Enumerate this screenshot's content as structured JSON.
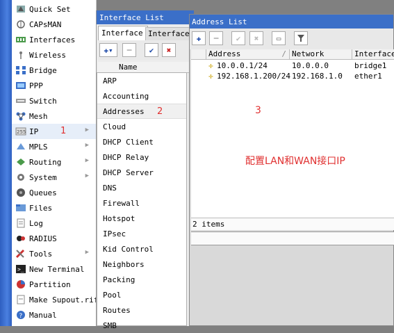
{
  "main_menu": [
    {
      "label": "Quick Set",
      "icon": "quick-set-icon"
    },
    {
      "label": "CAPsMAN",
      "icon": "capsman-icon"
    },
    {
      "label": "Interfaces",
      "icon": "interfaces-icon"
    },
    {
      "label": "Wireless",
      "icon": "wireless-icon"
    },
    {
      "label": "Bridge",
      "icon": "bridge-icon"
    },
    {
      "label": "PPP",
      "icon": "ppp-icon"
    },
    {
      "label": "Switch",
      "icon": "switch-icon"
    },
    {
      "label": "Mesh",
      "icon": "mesh-icon"
    },
    {
      "label": "IP",
      "icon": "ip-icon"
    },
    {
      "label": "MPLS",
      "icon": "mpls-icon"
    },
    {
      "label": "Routing",
      "icon": "routing-icon"
    },
    {
      "label": "System",
      "icon": "system-icon"
    },
    {
      "label": "Queues",
      "icon": "queues-icon"
    },
    {
      "label": "Files",
      "icon": "files-icon"
    },
    {
      "label": "Log",
      "icon": "log-icon"
    },
    {
      "label": "RADIUS",
      "icon": "radius-icon"
    },
    {
      "label": "Tools",
      "icon": "tools-icon"
    },
    {
      "label": "New Terminal",
      "icon": "terminal-icon"
    },
    {
      "label": "Partition",
      "icon": "partition-icon"
    },
    {
      "label": "Make Supout.rif",
      "icon": "supout-icon"
    },
    {
      "label": "Manual",
      "icon": "manual-icon"
    }
  ],
  "annotations": {
    "step1": "1",
    "step2": "2",
    "step3": "3",
    "note": "配置LAN和WAN接口IP"
  },
  "interface_window": {
    "title": "Interface List",
    "tab_active": "Interface",
    "tab_other": "Interface",
    "col_name": "Name"
  },
  "ip_submenu": [
    "ARP",
    "Accounting",
    "Addresses",
    "Cloud",
    "DHCP Client",
    "DHCP Relay",
    "DHCP Server",
    "DNS",
    "Firewall",
    "Hotspot",
    "IPsec",
    "Kid Control",
    "Neighbors",
    "Packing",
    "Pool",
    "Routes",
    "SMB"
  ],
  "address_window": {
    "title": "Address List",
    "columns": [
      "Address",
      "Network",
      "Interface"
    ],
    "rows": [
      {
        "address": "10.0.0.1/24",
        "network": "10.0.0.0",
        "interface": "bridge1"
      },
      {
        "address": "192.168.1.200/24",
        "network": "192.168.1.0",
        "interface": "ether1"
      }
    ],
    "status": "2 items"
  },
  "colors": {
    "title_bar": "#3b6fc8",
    "annotation": "#e03030",
    "strip": "#2e5fc0"
  }
}
